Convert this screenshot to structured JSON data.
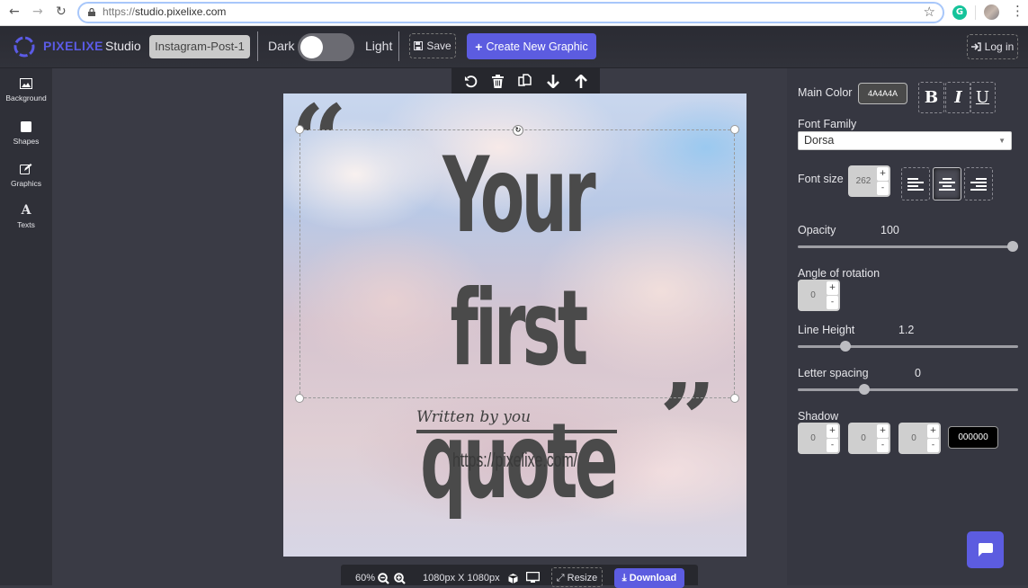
{
  "browser": {
    "url_prefix": "https://",
    "url_host": "studio.pixelixe.com",
    "extension_letter": "G"
  },
  "header": {
    "brand": "PIXELIXE",
    "product": "Studio",
    "document_name": "Instagram-Post-1",
    "theme_dark_label": "Dark",
    "theme_light_label": "Light",
    "theme_mode": "dark",
    "save_label": "Save",
    "create_label": "Create New Graphic",
    "login_label": "Log in",
    "accent_color": "#5c5ce0"
  },
  "sidebar": {
    "items": [
      {
        "label": "Background",
        "icon": "image-icon"
      },
      {
        "label": "Shapes",
        "icon": "square-icon"
      },
      {
        "label": "Graphics",
        "icon": "edit-icon"
      },
      {
        "label": "Texts",
        "icon": "text-icon"
      }
    ]
  },
  "object_toolbar": {
    "actions": [
      "undo",
      "delete",
      "duplicate",
      "move-down",
      "move-up"
    ]
  },
  "canvas": {
    "quote_open": "“",
    "quote_close": "”",
    "headline_line1": "Your first",
    "headline_line2": "quote",
    "author": "Written by you",
    "website": "https://pixelixe.com/",
    "text_color": "#4A4A4A"
  },
  "bottom_bar": {
    "zoom": "60%",
    "dimensions": "1080px X 1080px",
    "resize_label": "Resize",
    "download_label": "Download"
  },
  "properties": {
    "main_color_label": "Main Color",
    "main_color_value": "4A4A4A",
    "bold_label": "B",
    "italic_label": "I",
    "underline_label": "U",
    "font_family_label": "Font Family",
    "font_family_value": "Dorsa",
    "font_size_label": "Font size",
    "font_size_value": "262",
    "alignment": "center",
    "opacity_label": "Opacity",
    "opacity_value": "100",
    "opacity_fraction": 1.0,
    "rotation_label": "Angle of rotation",
    "rotation_value": "0",
    "line_height_label": "Line Height",
    "line_height_value": "1.2",
    "line_height_fraction": 0.2,
    "letter_spacing_label": "Letter spacing",
    "letter_spacing_value": "0",
    "letter_spacing_fraction": 0.29,
    "shadow_label": "Shadow",
    "shadow_x": "0",
    "shadow_y": "0",
    "shadow_blur": "0",
    "shadow_color": "000000",
    "stepper_plus": "+",
    "stepper_minus": "-"
  }
}
